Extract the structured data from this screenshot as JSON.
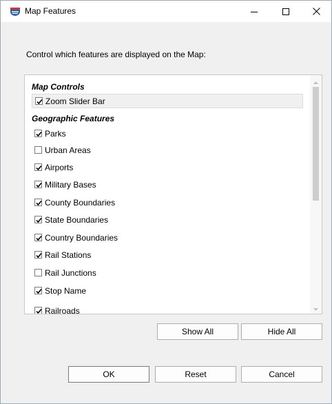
{
  "window": {
    "title": "Map Features"
  },
  "instruction": "Control which features are displayed on the Map:",
  "groups": {
    "map_controls": {
      "header": "Map Controls",
      "items": [
        {
          "label": "Zoom Slider Bar",
          "checked": true
        }
      ]
    },
    "geographic_features": {
      "header": "Geographic Features",
      "items": [
        {
          "label": "Parks",
          "checked": true
        },
        {
          "label": "Urban Areas",
          "checked": false
        },
        {
          "label": "Airports",
          "checked": true
        },
        {
          "label": "Military Bases",
          "checked": true
        },
        {
          "label": "County Boundaries",
          "checked": true
        },
        {
          "label": "State Boundaries",
          "checked": true
        },
        {
          "label": "Country Boundaries",
          "checked": true
        },
        {
          "label": "Rail Stations",
          "checked": true
        },
        {
          "label": "Rail Junctions",
          "checked": false
        },
        {
          "label": "Stop Name",
          "checked": true
        },
        {
          "label": "Railroads",
          "checked": true
        }
      ]
    }
  },
  "buttons": {
    "show_all": "Show All",
    "hide_all": "Hide All",
    "ok": "OK",
    "reset": "Reset",
    "cancel": "Cancel"
  },
  "icons": {
    "app": "map-app-icon",
    "minimize": "minimize-icon",
    "maximize": "maximize-icon",
    "close": "close-icon",
    "check": "checkmark-icon",
    "scroll_up": "scroll-up-arrow-icon",
    "scroll_down": "scroll-down-arrow-icon"
  },
  "colors": {
    "app_icon_red": "#d9342b",
    "app_icon_blue": "#2a5ea8"
  }
}
